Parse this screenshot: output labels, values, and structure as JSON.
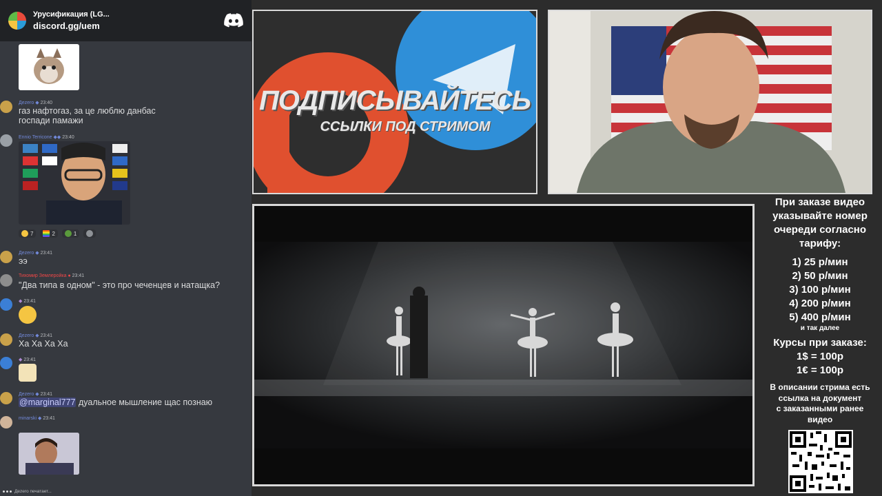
{
  "chat": {
    "server_name": "Урусификация (LG...",
    "server_link": "discord.gg/uem",
    "messages": [
      {
        "user": "Дezero",
        "time": "23:40",
        "lines": [
          "газ нафтогаз, за це люблю данбас",
          "госпади памажи"
        ]
      },
      {
        "user": "Ennio Terricone",
        "time": "23:40"
      },
      {
        "user": "Дezero",
        "time": "23:41",
        "lines": [
          "ээ"
        ]
      },
      {
        "user": "Тихомир Землеройка",
        "time": "23:41",
        "lines": [
          "\"Два типа в одном\" - это про чеченцев и натащка?"
        ]
      },
      {
        "user": "",
        "time": "23:41"
      },
      {
        "user": "Дezero",
        "time": "23:41",
        "lines": [
          "Ха Ха Ха Ха"
        ]
      },
      {
        "user": "",
        "time": "23:41"
      },
      {
        "user": "Дezero",
        "time": "23:41",
        "mention": "@marginal777",
        "lines": [
          "дуальное мышление щас познаю"
        ]
      },
      {
        "user": "minarski",
        "time": "23:41"
      }
    ],
    "reactions": [
      {
        "icon": "laugh-emoji-icon",
        "count": "7"
      },
      {
        "icon": "lgbt-emoji-icon",
        "count": "2"
      },
      {
        "icon": "pepe-emoji-icon",
        "count": "1"
      }
    ],
    "typing": "Дezero печатает..."
  },
  "promo": {
    "title": "ПОДПИСЫВАЙТЕСЬ",
    "subtitle": "ССЫЛКИ ПОД СТРИМОМ"
  },
  "info": {
    "heading": [
      "При заказе видео",
      "указывайте номер",
      "очереди согласно",
      "тарифу:"
    ],
    "prices": [
      "1) 25 р/мин",
      "2) 50 р/мин",
      "3) 100 р/мин",
      "4) 200 р/мин",
      "5) 400 р/мин"
    ],
    "etc": "и так далее",
    "rates_title": "Курсы при заказе:",
    "rates": [
      "1$ = 100р",
      "1€ = 100р"
    ],
    "desc": [
      "В описании стрима есть",
      "ссылка на документ",
      "с заказанными ранее",
      "видео"
    ]
  },
  "colors": {
    "discord_bg": "#36393f",
    "discord_header": "#202225",
    "username_blue": "#7289da",
    "username_red": "#f04747",
    "patreon_orange": "#e0502f",
    "telegram_blue": "#2f8fd8"
  }
}
